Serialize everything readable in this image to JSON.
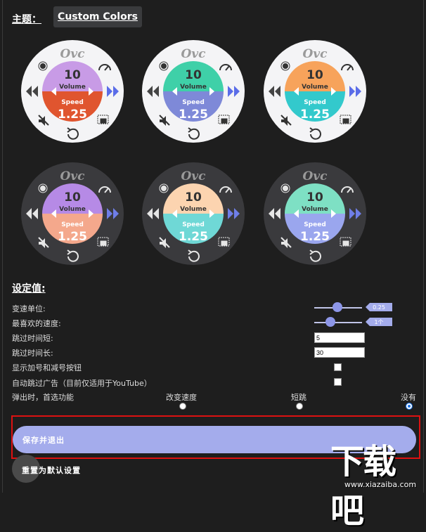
{
  "theme": {
    "label": "主题：",
    "selected": "Custom Colors"
  },
  "dial_common": {
    "brand": "Ovc",
    "top_value": "10",
    "top_label": "Volume",
    "bottom_label": "Speed",
    "bottom_value": "1.25"
  },
  "dials": [
    {
      "bg": "#f4f4f6",
      "top": "#c89be6",
      "bottom": "#e0552f",
      "icon": "#333333",
      "arrow_l": "#444444",
      "arrow_r": "#5a6ce8"
    },
    {
      "bg": "#f4f4f6",
      "top": "#3fd0a8",
      "bottom": "#7e89d8",
      "icon": "#333333",
      "arrow_l": "#444444",
      "arrow_r": "#5a6ce8"
    },
    {
      "bg": "#f4f4f6",
      "top": "#f7a35b",
      "bottom": "#33c9cc",
      "icon": "#333333",
      "arrow_l": "#444444",
      "arrow_r": "#5a6ce8"
    },
    {
      "bg": "#3a3a3d",
      "top": "#b68ae6",
      "bottom": "#f4a88c",
      "icon": "#e6e6e6",
      "arrow_l": "#e6e6e6",
      "arrow_r": "#6f7ee8"
    },
    {
      "bg": "#3a3a3d",
      "top": "#fcd4b0",
      "bottom": "#6fd8d6",
      "icon": "#e6e6e6",
      "arrow_l": "#e6e6e6",
      "arrow_r": "#6f7ee8"
    },
    {
      "bg": "#3a3a3d",
      "top": "#7ee0c4",
      "bottom": "#9aa6ee",
      "icon": "#e6e6e6",
      "arrow_l": "#e6e6e6",
      "arrow_r": "#6f7ee8"
    }
  ],
  "settings": {
    "title": "设定值:",
    "speed_unit": {
      "label": "变速单位:",
      "value": 0.25,
      "display": "0.25"
    },
    "favorite_speed": {
      "label": "最喜欢的速度:",
      "display": "1个"
    },
    "skip_short": {
      "label": "跳过时间短:",
      "value": "5"
    },
    "skip_long": {
      "label": "跳过时间长:",
      "value": "30"
    },
    "show_plus_minus": {
      "label": "显示加号和减号按钮",
      "checked": true
    },
    "auto_skip_ads": {
      "label": "自动跳过广告（目前仅适用于YouTube）",
      "checked": true
    },
    "popup_pref": {
      "label": "弹出时，首选功能",
      "options": [
        "改变速度",
        "短跳",
        "没有"
      ],
      "selected": "没有"
    }
  },
  "buttons": {
    "save": "保存并退出",
    "reset": "重置为默认设置"
  },
  "watermark": {
    "main": "下载吧",
    "url": "www.xiazaiba.com"
  }
}
